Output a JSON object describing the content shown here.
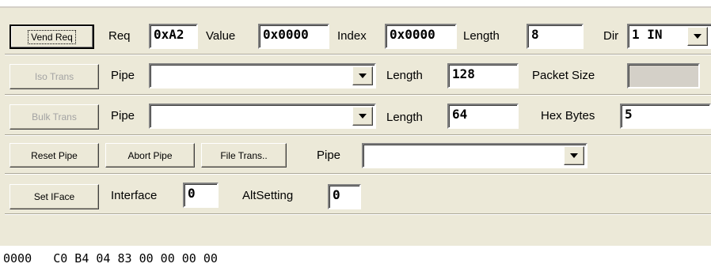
{
  "row1": {
    "vend_button": "Vend Req",
    "req_label": "Req",
    "req_value": "0xA2",
    "value_label": "Value",
    "value_value": "0x0000",
    "index_label": "Index",
    "index_value": "0x0000",
    "length_label": "Length",
    "length_value": "8",
    "dir_label": "Dir",
    "dir_value": "1 IN"
  },
  "row2": {
    "iso_button": "Iso Trans",
    "pipe_label": "Pipe",
    "pipe_value": "",
    "length_label": "Length",
    "length_value": "128",
    "packet_label": "Packet Size",
    "packet_value": ""
  },
  "row3": {
    "bulk_button": "Bulk Trans",
    "pipe_label": "Pipe",
    "pipe_value": "",
    "length_label": "Length",
    "length_value": "64",
    "hexbytes_label": "Hex Bytes",
    "hexbytes_value": "5"
  },
  "row4": {
    "reset_button": "Reset Pipe",
    "abort_button": "Abort Pipe",
    "file_button": "File Trans..",
    "pipe_label": "Pipe",
    "pipe_value": ""
  },
  "row5": {
    "setiface_button": "Set IFace",
    "interface_label": "Interface",
    "interface_value": "0",
    "altsetting_label": "AltSetting",
    "altsetting_value": "0"
  },
  "output": {
    "line1": "0000   C0 B4 04 83 00 00 00 00"
  }
}
